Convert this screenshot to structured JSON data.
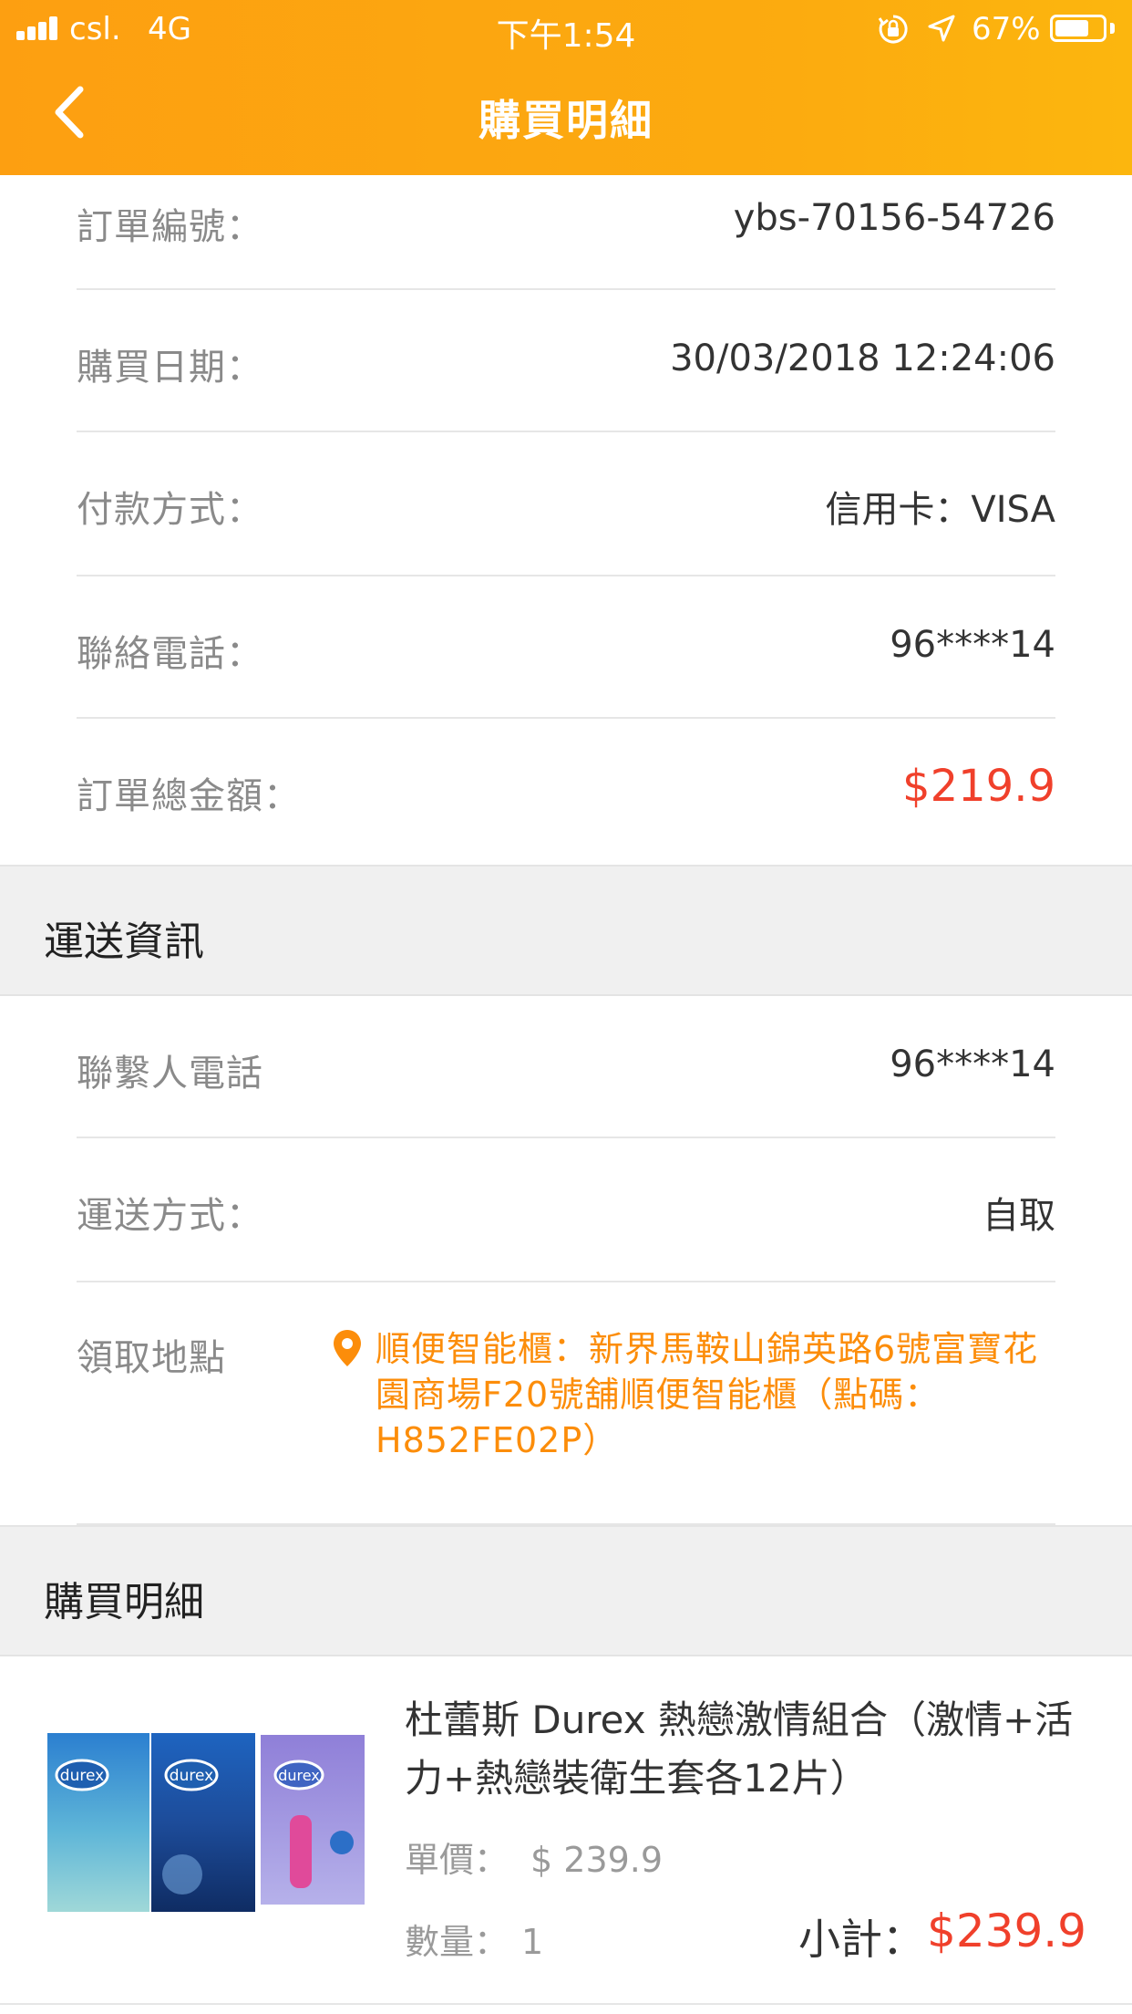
{
  "status_bar": {
    "carrier": "csl.",
    "network": "4G",
    "time": "下午1:54",
    "battery": "67%",
    "icons": [
      "signal-icon",
      "orientation-lock-icon",
      "location-icon",
      "battery-icon"
    ]
  },
  "header": {
    "title": "購買明細",
    "back_icon": "chevron-left-icon"
  },
  "order_info": {
    "order_no_label": "訂單編號：",
    "order_no": "ybs-70156-54726",
    "date_label": "購買日期：",
    "date": "30/03/2018 12:24:06",
    "payment_label": "付款方式：",
    "payment": "信用卡：VISA",
    "phone_label": "聯絡電話：",
    "phone": "96****14",
    "total_label": "訂單總金額：",
    "total": "$219.9"
  },
  "shipping": {
    "section_title": "運送資訊",
    "contact_label": "聯繫人電話",
    "contact": "96****14",
    "method_label": "運送方式：",
    "method": "自取",
    "pickup_label": "領取地點",
    "pickup_address": "順便智能櫃：新界馬鞍山錦英路6號富寶花園商場F20號舖順便智能櫃（點碼：H852FE02P）",
    "pickup_icon": "location-pin-icon"
  },
  "purchase": {
    "section_title": "購買明細",
    "items": [
      {
        "name": "杜蕾斯 Durex 熱戀激情組合（激情+活力+熱戀裝衛生套各12片）",
        "unit_price_label": "單價：",
        "unit_price": "$ 239.9",
        "qty_label": "數量：",
        "qty": "1",
        "subtotal_label": "小計：",
        "subtotal": "$239.9",
        "image_brand": "durex"
      }
    ]
  },
  "colors": {
    "header_orange": "#fda511",
    "price_red": "#f0402b",
    "address_orange": "#fc8d0a",
    "section_bg": "#f0f0f0"
  }
}
